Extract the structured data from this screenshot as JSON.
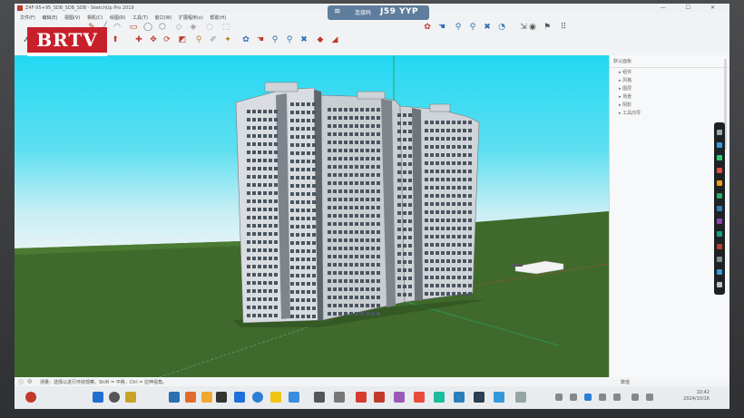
{
  "window": {
    "title": "Z4F-95+95_SDB_SDB_SDB - SketchUp Pro 2019",
    "controls": "— ☐ ✕"
  },
  "menu": {
    "items": [
      "文件(F)",
      "编辑(E)",
      "视图(V)",
      "相机(C)",
      "绘图(R)",
      "工具(T)",
      "窗口(W)",
      "扩展程序(x)",
      "帮助(H)"
    ]
  },
  "share": {
    "label": "连接码",
    "code": "J59 YYP"
  },
  "logo": {
    "text": "BRTV"
  },
  "panel": {
    "title": "默认面板",
    "items": [
      "▸ 组件",
      "▸ 风格",
      "▸ 图层",
      "▸ 场景",
      "▸ 阴影",
      "▸ 工具向导"
    ]
  },
  "statusbar": {
    "message": "测量：选择以进行环绕观察。Shift = 平移，Ctrl = 拉伸视角。",
    "right_label": "数值"
  },
  "clock": {
    "time": "10:42",
    "date": "2024/10/16"
  },
  "colors": {
    "sky": "#23d8f2",
    "ground": "#3f6a2b",
    "logo_bg": "#c8202a",
    "share_bg": "#5f7d9c"
  },
  "icons": {
    "toolbar1": [
      "pencil-icon",
      "line-icon",
      "arc-icon",
      "rectangle-icon",
      "circle-icon",
      "polygon-icon",
      "eraser-icon",
      "paint-icon",
      "move-icon",
      "rotate-icon",
      "scale-icon",
      "offset-icon"
    ],
    "toolbar2": [
      "select-icon",
      "push-pull-icon",
      "follow-me-icon",
      "rotate-icon",
      "move-icon",
      "paint-bucket-icon",
      "orbit-icon",
      "pan-icon",
      "zoom-icon",
      "zoom-extents-icon",
      "tape-icon",
      "protractor-icon",
      "text-icon",
      "axes-icon",
      "section-icon",
      "warehouse-icon"
    ],
    "toolbar_right": [
      "orbit-icon",
      "pan-icon",
      "zoom-icon",
      "zoom-window-icon",
      "zoom-extents-icon",
      "previous-icon",
      "walk-icon",
      "look-around-icon",
      "position-camera-icon",
      "footprints-icon"
    ]
  }
}
